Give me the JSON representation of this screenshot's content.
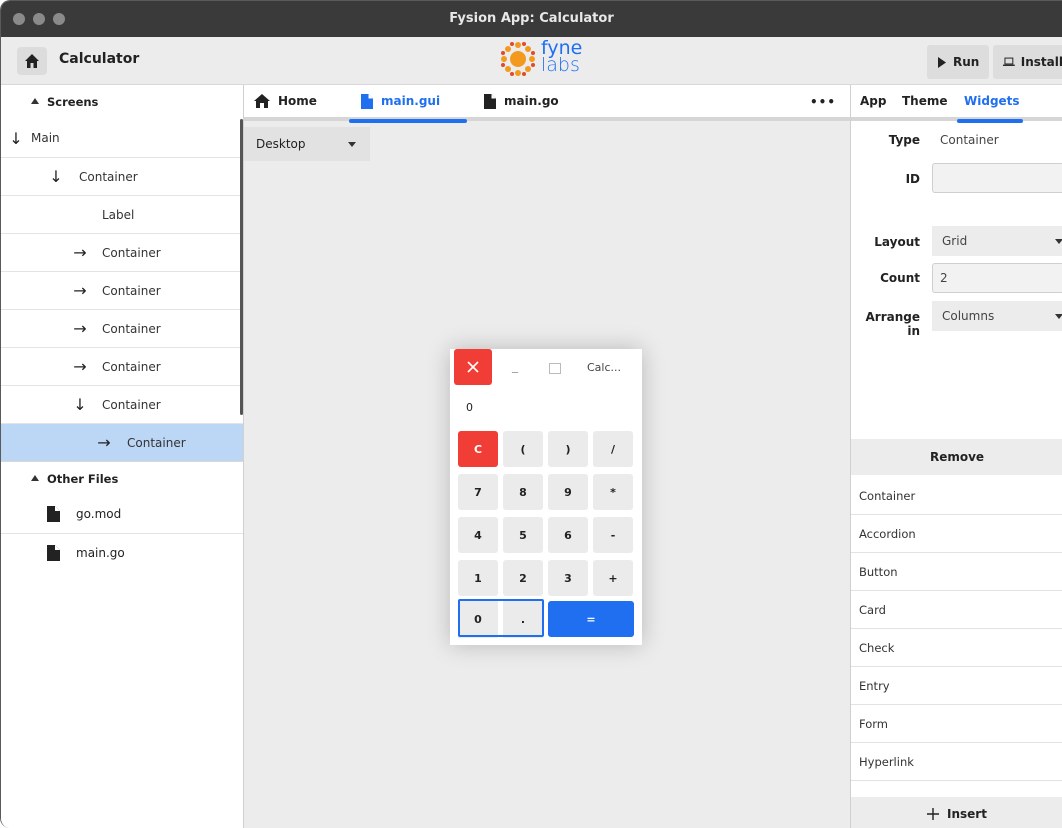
{
  "window": {
    "title": "Fysion App: Calculator"
  },
  "toolbar": {
    "app_title": "Calculator",
    "logo_text_top": "fyne",
    "logo_text_bottom": "labs",
    "run_label": "Run",
    "install_label": "Install"
  },
  "screens": {
    "header": "Screens",
    "tree": [
      {
        "arrow": "↓",
        "label": "Main"
      },
      {
        "arrow": "↓",
        "label": "Container"
      },
      {
        "arrow": "",
        "label": "Label"
      },
      {
        "arrow": "→",
        "label": "Container"
      },
      {
        "arrow": "→",
        "label": "Container"
      },
      {
        "arrow": "→",
        "label": "Container"
      },
      {
        "arrow": "→",
        "label": "Container"
      },
      {
        "arrow": "↓",
        "label": "Container"
      },
      {
        "arrow": "→",
        "label": "Container"
      }
    ]
  },
  "other_files": {
    "header": "Other Files",
    "files": [
      "go.mod",
      "main.go"
    ]
  },
  "editor": {
    "tabs": [
      "Home",
      "main.gui",
      "main.go"
    ],
    "more": "•••",
    "device": "Desktop"
  },
  "preview": {
    "window_title": "Calc...",
    "minimize": "_",
    "display": "0",
    "buttons": [
      [
        "C",
        "(",
        ")",
        "/"
      ],
      [
        "7",
        "8",
        "9",
        "*"
      ],
      [
        "4",
        "5",
        "6",
        "-"
      ],
      [
        "1",
        "2",
        "3",
        "+"
      ],
      [
        "0",
        ".",
        "="
      ]
    ]
  },
  "inspector": {
    "tabs": [
      "App",
      "Theme",
      "Widgets"
    ],
    "type_label": "Type",
    "type_value": "Container",
    "id_label": "ID",
    "id_value": "",
    "layout_label": "Layout",
    "layout_value": "Grid",
    "count_label": "Count",
    "count_value": "2",
    "arrange_label": "Arrange in",
    "arrange_value": "Columns",
    "remove_label": "Remove",
    "widgets": [
      "Container",
      "Accordion",
      "Button",
      "Card",
      "Check",
      "Entry",
      "Form",
      "Hyperlink"
    ],
    "insert_label": "Insert"
  },
  "colors": {
    "accent": "#1f6ff0",
    "danger": "#f03e36",
    "selection": "#bcd6f5"
  }
}
